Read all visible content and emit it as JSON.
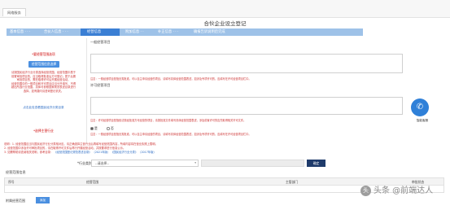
{
  "topbar": {
    "active_tab": "网络服务"
  },
  "page_title": "合伙企业设立登记",
  "steps": [
    {
      "label": "基本信息  ·  ·  ·"
    },
    {
      "label": "合伙人信息  ·  ·  ·"
    },
    {
      "label": "经营信息"
    },
    {
      "label": "附加信息  ·  ·"
    },
    {
      "label": "补正信息  ·  ·  ·"
    },
    {
      "label": "确报告诉说明后完成"
    }
  ],
  "left_panel": {
    "required_label": "*要经营范围选项",
    "required_label_suffix": "",
    "select_button": "经营范围信息选择",
    "notes": [
      "请按国民经济行业分类选择经营范围。经营范围中属于",
      "前置审批项目的，应当取得批准后方可登记；属于后置",
      "审批项目的，需在取得许可后开展经营活动。",
      "经营范围中的一般项目和许可项目应当分开填写，不得",
      "超出所选行业范围，具体可参照国家规范表述目录进行",
      "选择，如有疑问请咨询登记机关。"
    ],
    "link": "点击此处查看国民经济分类目录",
    "main_label": "*选择主营行业"
  },
  "sections": {
    "general_items": "一般经营项目",
    "licensed_items": "许可经营项目"
  },
  "hints": {
    "general": "注意：一般经营项目是指无需批准，可以自主申请经营的项目，请填写具体经营范围表述，如涉及专项许可的，应填写在许可经营项目栏中。",
    "licensed": "注意：许可经营项目是指依法需经批准方可经营的项目，请按批准文件填写具体经营范围表述，涉及前置许可的应先取得相关许可文件。"
  },
  "radio": {
    "yes": "是",
    "no": "否"
  },
  "notes_block": [
    {
      "text": "说明：1. 经营范围应当与国民经济行业分类相对应，请正确选择主营行业后再填写经营范围内容，所填内容将在营业执照上载明。",
      "blue": ""
    },
    {
      "text": "2. 经营范围中涉及许可审批项目的，请在取得许可文件后再行开展经营活动，并按要求进行信息公示。",
      "blue": ""
    },
    {
      "text": "3. 如需帮助请查阅相关说明，参考目录：",
      "blue": "《经营范围登记规范表述目录》 （2021年版）    《国民经济行业分类》 （2017年版）"
    }
  ],
  "industry": {
    "label": "*行业类别：",
    "select_value": "--请选择--",
    "confirm": "确定"
  },
  "scope_table": {
    "title": "经营范围信息",
    "headers": [
      "序号",
      "经营范围",
      "主管部门",
      "审批状态"
    ]
  },
  "bottom": {
    "label": "附属经营范围",
    "add_button": "添加"
  },
  "chat": {
    "label": "智能客服"
  },
  "watermark": {
    "icon": "头",
    "text": "头条 @前端达人"
  },
  "colors": {
    "primary": "#4a8fe0",
    "step_bar": "#9ec2e8",
    "step_active": "#3b7fd4",
    "warning": "#cc3333"
  }
}
